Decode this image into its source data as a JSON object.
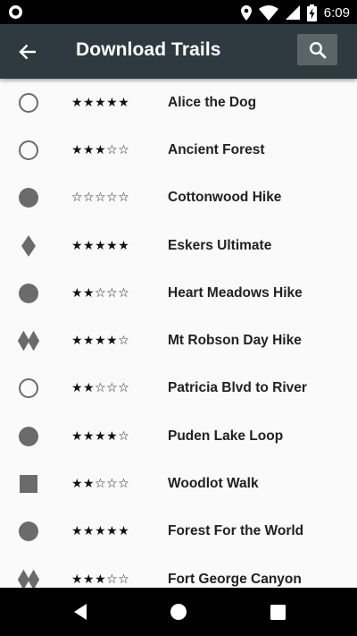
{
  "status_bar": {
    "time": "6:09",
    "icons": [
      "location-icon",
      "wifi-icon",
      "battery-charging-icon"
    ]
  },
  "app_bar": {
    "title": "Download Trails",
    "back_icon": "arrow-back-icon",
    "search_icon": "search-icon"
  },
  "trails": [
    {
      "name": "Alice the Dog",
      "difficulty": "circle-open",
      "rating": 5
    },
    {
      "name": "Ancient Forest",
      "difficulty": "circle-open",
      "rating": 3
    },
    {
      "name": "Cottonwood Hike",
      "difficulty": "circle-filled",
      "rating": 0
    },
    {
      "name": "Eskers Ultimate",
      "difficulty": "diamond",
      "rating": 5
    },
    {
      "name": "Heart Meadows Hike",
      "difficulty": "circle-filled",
      "rating": 2
    },
    {
      "name": "Mt Robson Day Hike",
      "difficulty": "double-diamond",
      "rating": 4
    },
    {
      "name": "Patricia Blvd to River",
      "difficulty": "circle-open",
      "rating": 2
    },
    {
      "name": "Puden Lake Loop",
      "difficulty": "circle-filled",
      "rating": 4
    },
    {
      "name": "Woodlot Walk",
      "difficulty": "square",
      "rating": 2
    },
    {
      "name": "Forest For the World",
      "difficulty": "circle-filled",
      "rating": 5
    },
    {
      "name": "Fort George Canyon",
      "difficulty": "double-diamond",
      "rating": 3
    }
  ],
  "nav_bar": {
    "buttons": [
      "back-triangle-icon",
      "home-circle-icon",
      "recents-square-icon"
    ]
  }
}
